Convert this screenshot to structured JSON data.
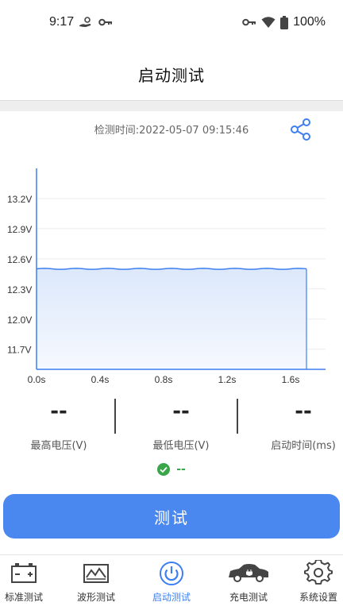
{
  "status_bar": {
    "time": "9:17",
    "battery": "100%"
  },
  "header": {
    "title": "启动测试"
  },
  "info": {
    "detect_time": "检测时间:2022-05-07 09:15:46"
  },
  "chart_data": {
    "type": "area",
    "x": [
      0.0,
      0.1,
      0.2,
      0.3,
      0.4,
      0.5,
      0.6,
      0.7,
      0.8,
      0.9,
      1.0,
      1.1,
      1.2,
      1.3,
      1.4,
      1.5,
      1.6,
      1.7
    ],
    "y": [
      12.5,
      12.5,
      12.5,
      12.5,
      12.5,
      12.5,
      12.5,
      12.5,
      12.5,
      12.5,
      12.5,
      12.5,
      12.5,
      12.5,
      12.5,
      12.5,
      12.5,
      12.5
    ],
    "xlim": [
      0,
      1.82
    ],
    "ylim": [
      11.5,
      13.5
    ],
    "x_ticks": [
      "0.0s",
      "0.4s",
      "0.8s",
      "1.2s",
      "1.6s"
    ],
    "x_tick_values": [
      0.0,
      0.4,
      0.8,
      1.2,
      1.6
    ],
    "y_ticks": [
      "13.2V",
      "12.9V",
      "12.6V",
      "12.3V",
      "12.0V",
      "11.7V"
    ],
    "y_tick_values": [
      13.2,
      12.9,
      12.6,
      12.3,
      12.0,
      11.7
    ],
    "grid": true,
    "line_color": "#3d7ff0",
    "fill_color": "#dce8fb"
  },
  "stats": [
    {
      "value": "--",
      "label": "最高电压(V)"
    },
    {
      "value": "--",
      "label": "最低电压(V)"
    },
    {
      "value": "--",
      "label": "启动时间(ms)"
    }
  ],
  "result": {
    "text": "--",
    "color": "#3aa64a"
  },
  "test_button": {
    "label": "测试",
    "color": "#4a88ef"
  },
  "nav": [
    {
      "label": "标准测试",
      "icon": "battery-icon"
    },
    {
      "label": "波形测试",
      "icon": "waveform-icon"
    },
    {
      "label": "启动测试",
      "icon": "power-icon",
      "active": true
    },
    {
      "label": "充电测试",
      "icon": "ev-car-icon"
    },
    {
      "label": "系统设置",
      "icon": "gear-icon"
    }
  ],
  "colors": {
    "accent": "#3d7ff0"
  }
}
